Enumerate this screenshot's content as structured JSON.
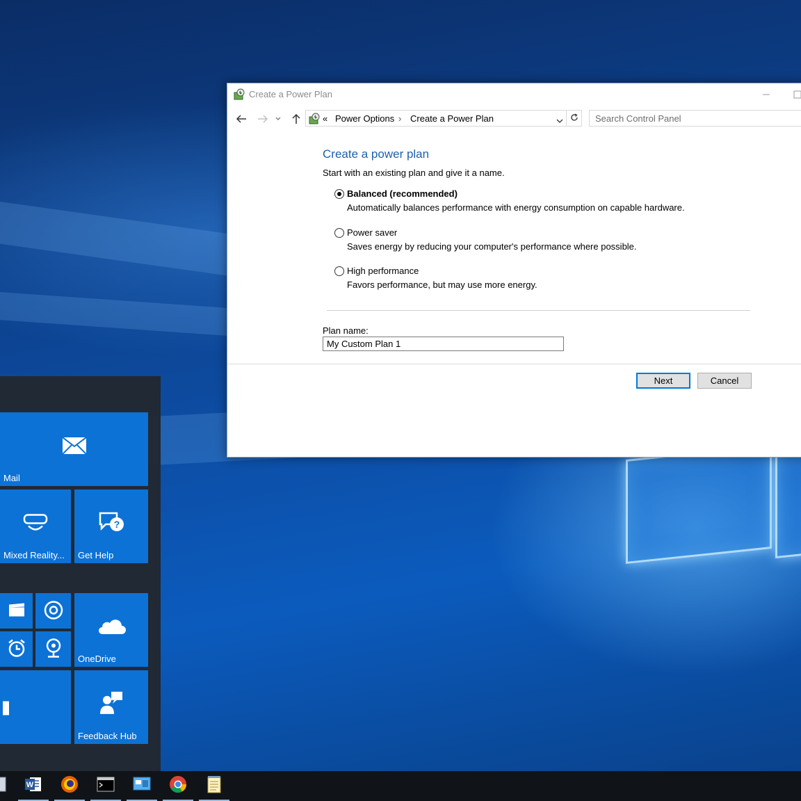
{
  "window": {
    "title": "Create a Power Plan",
    "address": {
      "overflow": "«",
      "crumbs": [
        "Power Options",
        "Create a Power Plan"
      ],
      "separator": "›"
    },
    "search_placeholder": "Search Control Panel"
  },
  "main": {
    "heading": "Create a power plan",
    "subtitle": "Start with an existing plan and give it a name.",
    "plans": [
      {
        "label": "Balanced (recommended)",
        "description": "Automatically balances performance with energy consumption on capable hardware.",
        "selected": true
      },
      {
        "label": "Power saver",
        "description": "Saves energy by reducing your computer's performance where possible.",
        "selected": false
      },
      {
        "label": "High performance",
        "description": "Favors performance, but may use more energy.",
        "selected": false
      }
    ],
    "plan_name_label": "Plan name:",
    "plan_name_value": "My Custom Plan 1"
  },
  "buttons": {
    "next": "Next",
    "cancel": "Cancel"
  },
  "start_menu": {
    "tiles": [
      {
        "label": "Mail",
        "icon": "mail-icon"
      },
      {
        "label": "Mixed Reality...",
        "icon": "mixed-reality-icon"
      },
      {
        "label": "Get Help",
        "icon": "get-help-icon"
      },
      {
        "label": "OneDrive",
        "icon": "onedrive-icon"
      },
      {
        "label": "Feedback Hub",
        "icon": "feedback-hub-icon"
      }
    ],
    "small_tiles": [
      "movies-icon",
      "groove-music-icon",
      "alarms-icon",
      "maps-icon",
      "store-icon"
    ]
  },
  "taskbar": {
    "apps": [
      "file-icon",
      "word-icon",
      "firefox-icon",
      "command-prompt-icon",
      "control-panel-icon",
      "chrome-icon",
      "notepad-icon"
    ]
  },
  "colors": {
    "accent": "#0c72d6",
    "heading_blue": "#1e5fae",
    "default_button_border": "#0078d7"
  }
}
